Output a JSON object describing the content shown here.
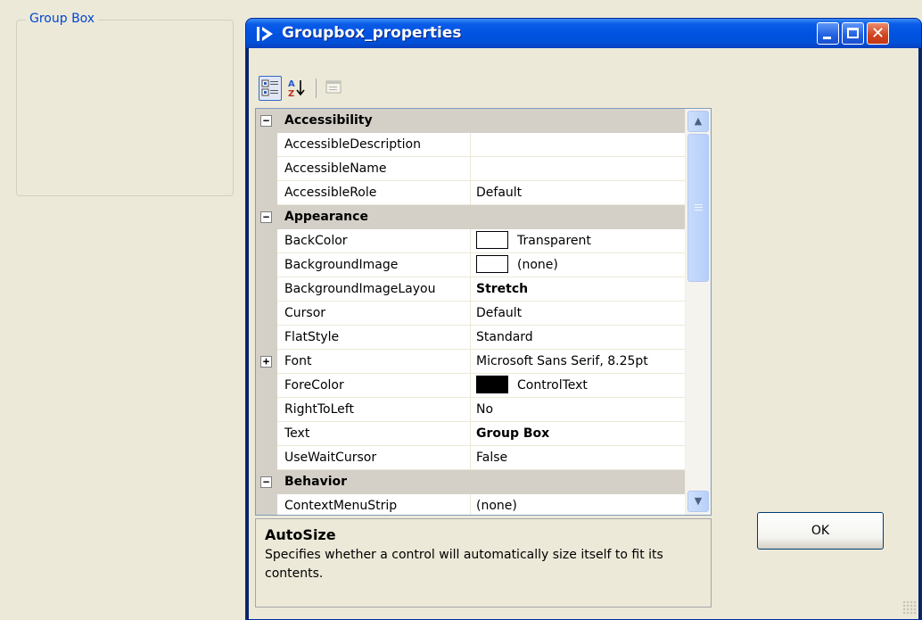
{
  "background": {
    "groupbox_title": "Group Box"
  },
  "window": {
    "title": "Groupbox_properties",
    "icon": "app-arrow-icon",
    "controls": [
      "minimize",
      "maximize",
      "close"
    ]
  },
  "toolbar": {
    "buttons": [
      {
        "name": "categorized-view",
        "icon": "categorized-icon",
        "active": true
      },
      {
        "name": "alphabetical-view",
        "icon": "sort-az-icon",
        "active": false
      },
      {
        "name": "property-pages",
        "icon": "property-pages-icon",
        "enabled": false
      }
    ]
  },
  "grid": {
    "categories": [
      {
        "name": "Accessibility",
        "properties": [
          {
            "name": "AccessibleDescription",
            "value": ""
          },
          {
            "name": "AccessibleName",
            "value": ""
          },
          {
            "name": "AccessibleRole",
            "value": "Default"
          }
        ]
      },
      {
        "name": "Appearance",
        "properties": [
          {
            "name": "BackColor",
            "value": "Transparent",
            "swatch": "#ffffff"
          },
          {
            "name": "BackgroundImage",
            "value": "(none)",
            "swatch": "#ffffff"
          },
          {
            "name": "BackgroundImageLayou",
            "value": "Stretch",
            "bold": true
          },
          {
            "name": "Cursor",
            "value": "Default"
          },
          {
            "name": "FlatStyle",
            "value": "Standard"
          },
          {
            "name": "Font",
            "value": "Microsoft Sans Serif, 8.25pt",
            "expandable": true
          },
          {
            "name": "ForeColor",
            "value": "ControlText",
            "swatch": "#000000"
          },
          {
            "name": "RightToLeft",
            "value": "No"
          },
          {
            "name": "Text",
            "value": "Group Box",
            "bold": true
          },
          {
            "name": "UseWaitCursor",
            "value": "False"
          }
        ]
      },
      {
        "name": "Behavior",
        "properties": [
          {
            "name": "ContextMenuStrip",
            "value": "(none)"
          }
        ]
      }
    ]
  },
  "help": {
    "title": "AutoSize",
    "description": "Specifies whether a control will automatically size itself to fit its contents."
  },
  "ok_label": "OK",
  "colors": {
    "titlebar": "#0053e1",
    "category_bg": "#d4d0c8",
    "dialog_bg": "#ece9d8"
  }
}
